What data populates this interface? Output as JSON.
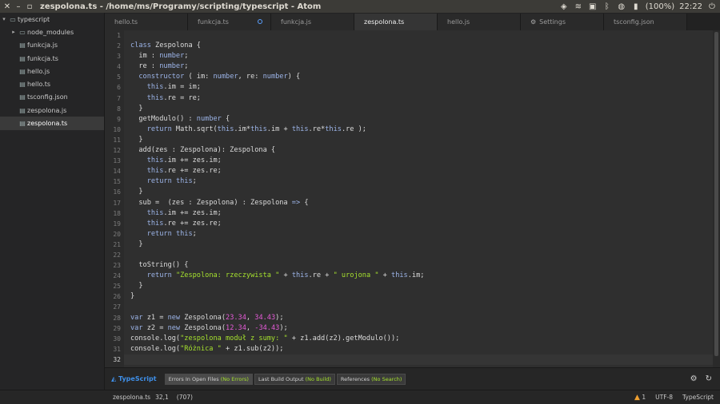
{
  "window": {
    "title": "zespolona.ts - /home/ms/Programy/scripting/typescript - Atom"
  },
  "tray": {
    "battery": "(100%)",
    "time": "22:22"
  },
  "tree": {
    "root": "typescript",
    "items": [
      {
        "label": "node_modules",
        "type": "folder"
      },
      {
        "label": "funkcja.js",
        "type": "file"
      },
      {
        "label": "funkcja.ts",
        "type": "file"
      },
      {
        "label": "hello.js",
        "type": "file"
      },
      {
        "label": "hello.ts",
        "type": "file"
      },
      {
        "label": "tsconfig.json",
        "type": "file"
      },
      {
        "label": "zespolona.js",
        "type": "file"
      },
      {
        "label": "zespolona.ts",
        "type": "file"
      }
    ]
  },
  "tabs": [
    "hello.ts",
    "funkcja.ts",
    "funkcja.js",
    "zespolona.ts",
    "hello.js",
    "Settings",
    "tsconfig.json"
  ],
  "lines": [
    "",
    "class Zespolona {",
    "  im : number;",
    "  re : number;",
    "  constructor ( im: number, re: number) {",
    "    this.im = im;",
    "    this.re = re;",
    "  }",
    "  getModulo() : number {",
    "    return Math.sqrt(this.im*this.im + this.re*this.re );",
    "  }",
    "  add(zes : Zespolona): Zespolona {",
    "    this.im += zes.im;",
    "    this.re += zes.re;",
    "    return this;",
    "  }",
    "  sub =  (zes : Zespolona) : Zespolona => {",
    "    this.im += zes.im;",
    "    this.re += zes.re;",
    "    return this;",
    "  }",
    "",
    "  toString() {",
    "    return \"Zespolona: rzeczywista \" + this.re + \" urojona \" + this.im;",
    "  }",
    "}",
    "",
    "var z1 = new Zespolona(23.34, 34.43);",
    "var z2 = new Zespolona(12.34, -34.43);",
    "console.log(\"zespolona moduł z sumy: \" + z1.add(z2).getModulo());",
    "console.log(\"Różnica \" + z1.sub(z2));",
    ""
  ],
  "panel": {
    "brand": "TypeScript",
    "buttons": [
      {
        "label": "Errors In Open Files",
        "badge": "(No Errors)"
      },
      {
        "label": "Last Build Output",
        "badge": "(No Build)"
      },
      {
        "label": "References",
        "badge": "(No Search)"
      }
    ]
  },
  "status": {
    "file": "zespolona.ts",
    "cursor": "32,1",
    "chars": "(707)",
    "warnings": "1",
    "encoding": "UTF-8",
    "grammar": "TypeScript"
  }
}
